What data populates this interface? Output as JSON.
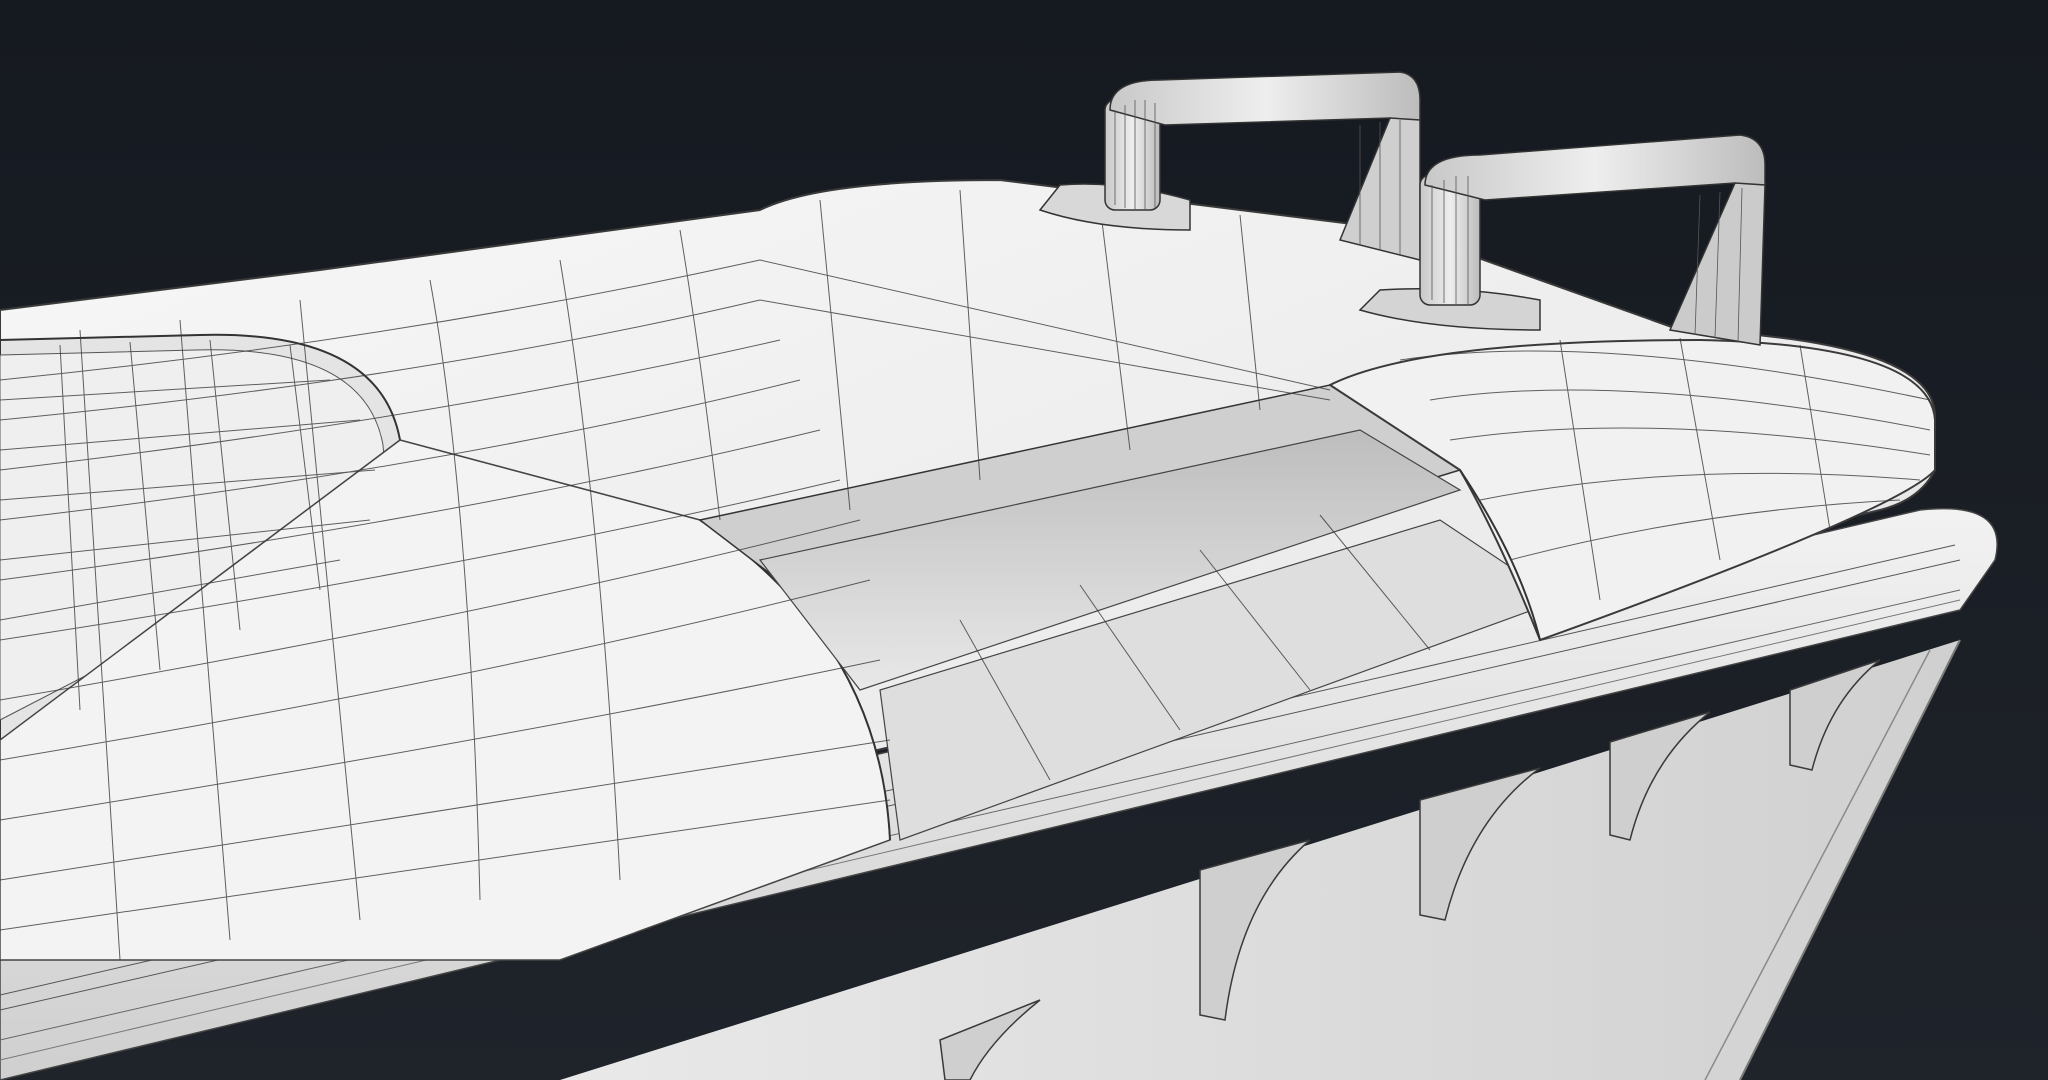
{
  "scene": {
    "subject": "wheelie bin lid",
    "render_style": "clay wireframe",
    "colors": {
      "background_top": "#151920",
      "background_bottom": "#1f232a",
      "surface_light": "#f4f4f4",
      "surface_mid": "#d9d9d9",
      "surface_shadow": "#9a9a9a",
      "wire": "#3a3a3a",
      "wire_dense": "#4d4d4d"
    },
    "parts": [
      "lid",
      "left-lid-panel",
      "center-slot-opening",
      "hinge-handle-left",
      "hinge-handle-right",
      "bin-body",
      "body-ribs"
    ]
  }
}
